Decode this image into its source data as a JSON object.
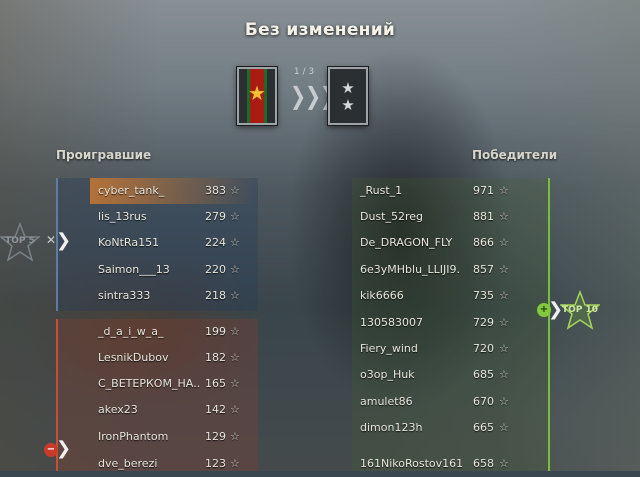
{
  "header": {
    "title": "Без изменений",
    "progress": "1 / 3"
  },
  "columns": {
    "losers": "Проигравшие",
    "winners": "Победители"
  },
  "badges": {
    "top5": "TOP 5",
    "top10": "TOP 10"
  },
  "losers": [
    {
      "name": "cyber_tank_",
      "score": "383",
      "icon": "☆"
    },
    {
      "name": "lis_13rus",
      "score": "279",
      "icon": "☆"
    },
    {
      "name": "KoNtRa151",
      "score": "224",
      "icon": "☆"
    },
    {
      "name": "Saimon___13",
      "score": "220",
      "icon": "☆"
    },
    {
      "name": "sintra333",
      "score": "218",
      "icon": "☆"
    },
    {
      "name": "_d_a_i_w_a_",
      "score": "199",
      "icon": "☆"
    },
    {
      "name": "LesnikDubov",
      "score": "182",
      "icon": "☆"
    },
    {
      "name": "С_ВЕТЕРКОМ_НА..",
      "score": "165",
      "icon": "☆"
    },
    {
      "name": "akex23",
      "score": "142",
      "icon": "☆"
    },
    {
      "name": "IronPhantom",
      "score": "129",
      "icon": "☆"
    },
    {
      "name": "dve_berezi",
      "score": "123",
      "icon": "☆"
    }
  ],
  "winners": [
    {
      "name": "_Rust_1",
      "score": "971",
      "icon": "☆"
    },
    {
      "name": "Dust_52reg",
      "score": "881",
      "icon": "☆"
    },
    {
      "name": "De_DRAGON_FLY",
      "score": "866",
      "icon": "☆"
    },
    {
      "name": "6e3yMHblu_LLIJI9.",
      "score": "857",
      "icon": "☆"
    },
    {
      "name": "kik6666",
      "score": "735",
      "icon": "☆"
    },
    {
      "name": "130583007",
      "score": "729",
      "icon": "☆"
    },
    {
      "name": "Fiery_wind",
      "score": "720",
      "icon": "☆"
    },
    {
      "name": "o3op_Huk",
      "score": "685",
      "icon": "☆"
    },
    {
      "name": "amulet86",
      "score": "670",
      "icon": "☆"
    },
    {
      "name": "dimon123h",
      "score": "665",
      "icon": "☆"
    },
    {
      "name": "161NikoRostov161",
      "score": "658",
      "icon": "☆"
    }
  ],
  "colors": {
    "highlight": "#c87832",
    "loser_bar": "#d2503c",
    "safe_bar": "#6482aa",
    "winner_bar": "#82c83c",
    "rank_star_old": "#f2c230"
  }
}
